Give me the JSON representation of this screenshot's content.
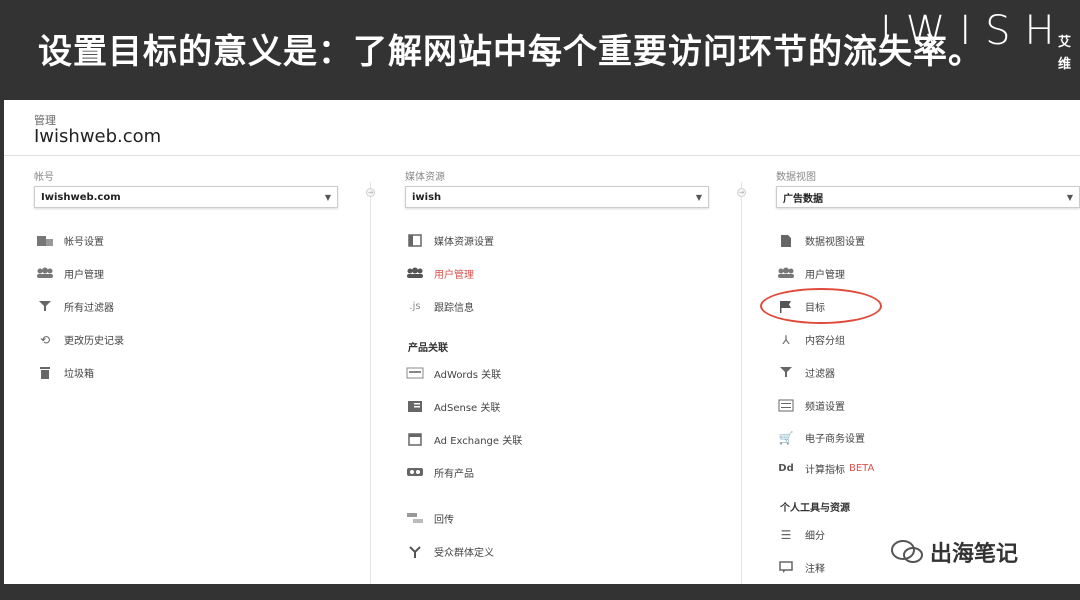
{
  "banner": {
    "headline": "设置目标的意义是：了解网站中每个重要访问环节的流失率。",
    "logo": "IWISH",
    "logo_cn": "艾维"
  },
  "header": {
    "admin_label": "管理",
    "site_title": "Iwishweb.com"
  },
  "account_col": {
    "label": "帐号",
    "selected": "Iwishweb.com",
    "items": [
      {
        "label": "帐号设置",
        "icon": "building-icon"
      },
      {
        "label": "用户管理",
        "icon": "users-icon"
      },
      {
        "label": "所有过滤器",
        "icon": "filter-icon"
      },
      {
        "label": "更改历史记录",
        "icon": "history-icon"
      },
      {
        "label": "垃圾箱",
        "icon": "trash-icon"
      }
    ]
  },
  "property_col": {
    "label": "媒体资源",
    "selected": "iwish",
    "items": [
      {
        "label": "媒体资源设置",
        "icon": "window-icon"
      },
      {
        "label": "用户管理",
        "icon": "users-icon"
      },
      {
        "label": "跟踪信息",
        "icon": "js-icon"
      }
    ],
    "section_label": "产品关联",
    "product_items": [
      {
        "label": "AdWords 关联",
        "icon": "adwords-icon"
      },
      {
        "label": "AdSense 关联",
        "icon": "adsense-icon"
      },
      {
        "label": "Ad Exchange 关联",
        "icon": "adexchange-icon"
      },
      {
        "label": "所有产品",
        "icon": "products-icon"
      }
    ],
    "extra_items": [
      {
        "label": "回传",
        "icon": "postback-icon"
      },
      {
        "label": "受众群体定义",
        "icon": "audience-icon"
      }
    ]
  },
  "view_col": {
    "label": "数据视图",
    "selected": "广告数据",
    "items": [
      {
        "label": "数据视图设置",
        "icon": "document-icon"
      },
      {
        "label": "用户管理",
        "icon": "users-icon"
      },
      {
        "label": "目标",
        "icon": "flag-icon"
      },
      {
        "label": "内容分组",
        "icon": "grouping-icon"
      },
      {
        "label": "过滤器",
        "icon": "filter-icon"
      },
      {
        "label": "频道设置",
        "icon": "sliders-icon"
      },
      {
        "label": "电子商务设置",
        "icon": "cart-icon"
      },
      {
        "label": "计算指标",
        "icon": "dd-icon",
        "badge": "BETA"
      }
    ],
    "section_label": "个人工具与资源",
    "tool_items": [
      {
        "label": "细分",
        "icon": "segments-icon"
      },
      {
        "label": "注释",
        "icon": "comment-icon"
      }
    ]
  },
  "watermark": {
    "text": "出海笔记"
  },
  "colors": {
    "accent_red": "#d9534f",
    "highlight_circle": "#e04a3b",
    "banner_bg": "#333333"
  }
}
